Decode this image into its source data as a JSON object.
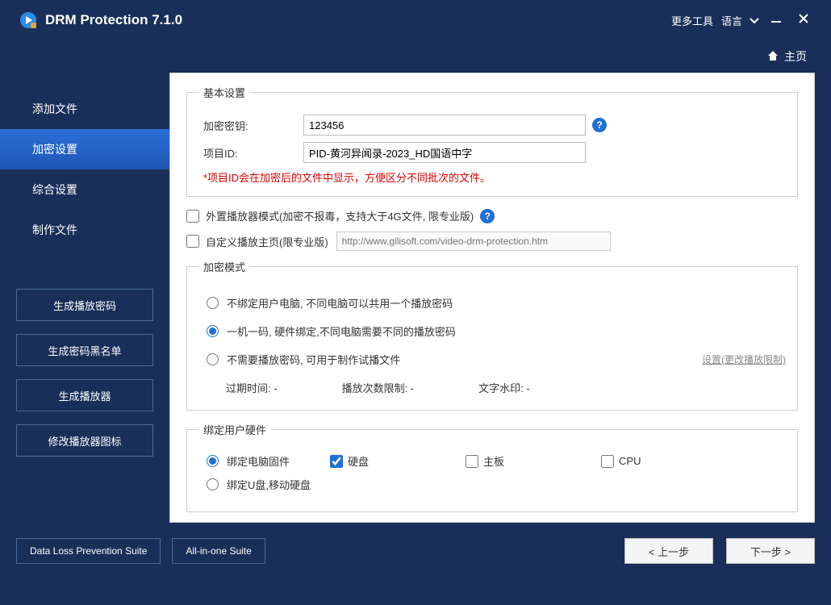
{
  "titlebar": {
    "app_title": "DRM Protection 7.1.0",
    "more_tools": "更多工具",
    "language": "语言"
  },
  "tabbar": {
    "home": "主页"
  },
  "sidebar": {
    "nav": [
      {
        "label": "添加文件",
        "active": false
      },
      {
        "label": "加密设置",
        "active": true
      },
      {
        "label": "综合设置",
        "active": false
      },
      {
        "label": "制作文件",
        "active": false
      }
    ],
    "buttons": {
      "gen_pwd": "生成播放密码",
      "gen_blacklist": "生成密码黑名单",
      "gen_player": "生成播放器",
      "modify_icon": "修改播放器图标"
    }
  },
  "content": {
    "basic": {
      "legend": "基本设置",
      "key_label": "加密密钥:",
      "key_value": "123456",
      "pid_label": "项目ID:",
      "pid_value": "PID-黄河异闻录-2023_HD国语中字",
      "note": "*项目ID会在加密后的文件中显示，方便区分不同批次的文件。"
    },
    "external_player": "外置播放器模式(加密不报毒，支持大于4G文件, 限专业版)",
    "custom_homepage": "自定义播放主页(限专业版)",
    "custom_url_placeholder": "http://www.gilisoft.com/video-drm-protection.htm",
    "mode": {
      "legend": "加密模式",
      "opt_unbind": "不绑定用户电脑, 不同电脑可以共用一个播放密码",
      "opt_bind": "一机一码, 硬件绑定,不同电脑需要不同的播放密码",
      "opt_nopwd": "不需要播放密码, 可用于制作试播文件",
      "settings_link": "设置(更改播放限制)",
      "expire": "过期时间: -",
      "playcount": "播放次数限制: -",
      "watermark": "文字水印: -"
    },
    "hardware": {
      "legend": "绑定用户硬件",
      "opt_pc": "绑定电脑固件",
      "opt_usb": "绑定U盘,移动硬盘",
      "hdd": "硬盘",
      "mb": "主板",
      "cpu": "CPU"
    }
  },
  "footer": {
    "dlp": "Data Loss Prevention Suite",
    "aio": "All-in-one Suite",
    "prev": "< 上一步",
    "next": "下一步 >"
  }
}
